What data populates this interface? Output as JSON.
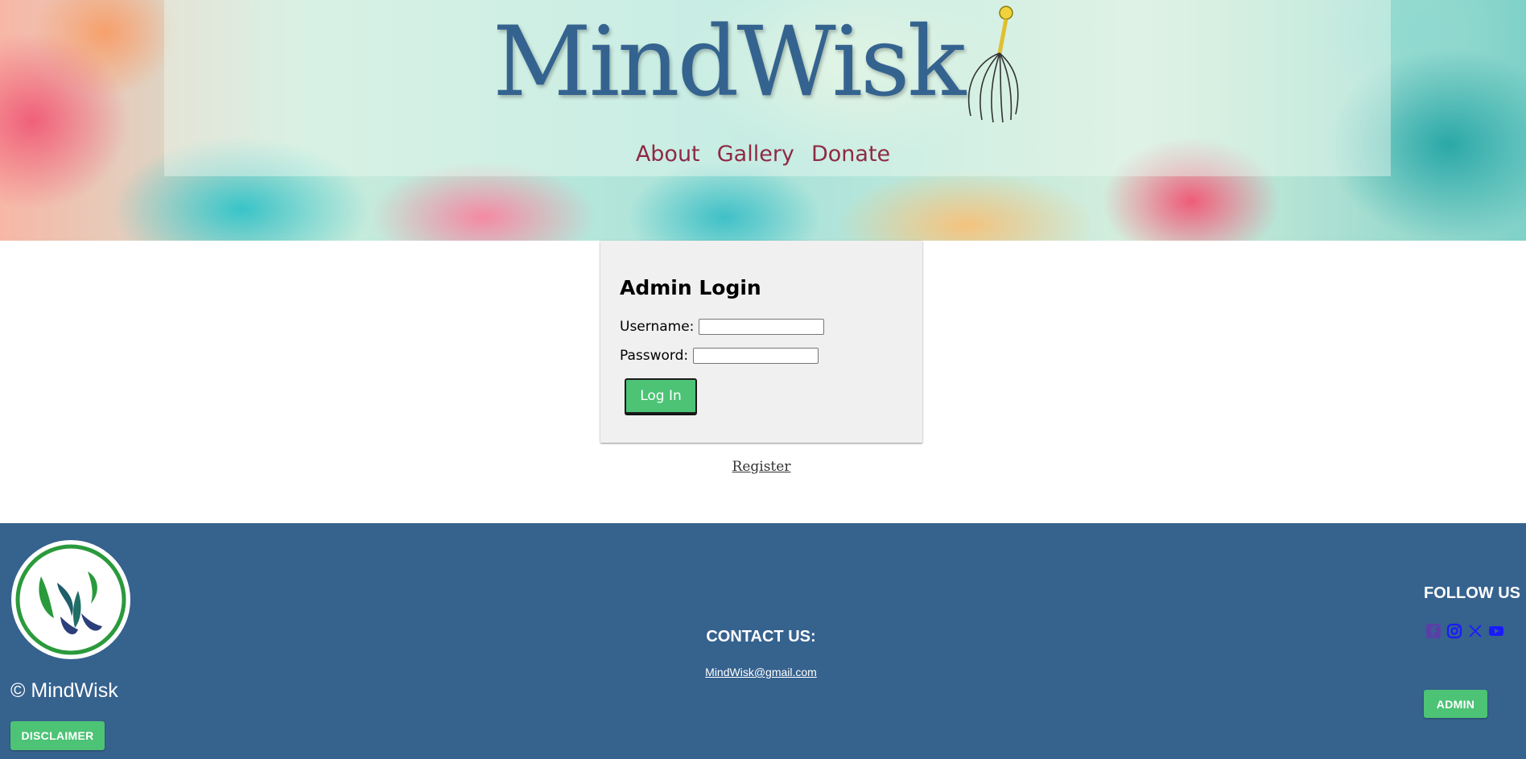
{
  "header": {
    "site_title": "MindWisk",
    "nav": [
      {
        "label": "About"
      },
      {
        "label": "Gallery"
      },
      {
        "label": "Donate"
      }
    ]
  },
  "login": {
    "title": "Admin Login",
    "username_label": "Username:",
    "username_value": "",
    "password_label": "Password:",
    "password_value": "",
    "submit_label": "Log In"
  },
  "register_link": "Register",
  "footer": {
    "copyright": "© MindWisk",
    "disclaimer_label": "DISCLAIMER",
    "contact_title": "CONTACT US:",
    "contact_email": "MindWisk@gmail.com",
    "follow_title": "FOLLOW US",
    "social_icons": [
      "facebook-icon",
      "instagram-icon",
      "x-icon",
      "youtube-icon"
    ],
    "admin_label": "ADMIN"
  },
  "colors": {
    "title": "#34638f",
    "nav_link": "#8e2a44",
    "button_green": "#4cc375",
    "footer_bg": "#36628e",
    "card_bg": "#f0f0f0",
    "social_icon": "#1a1aff"
  }
}
